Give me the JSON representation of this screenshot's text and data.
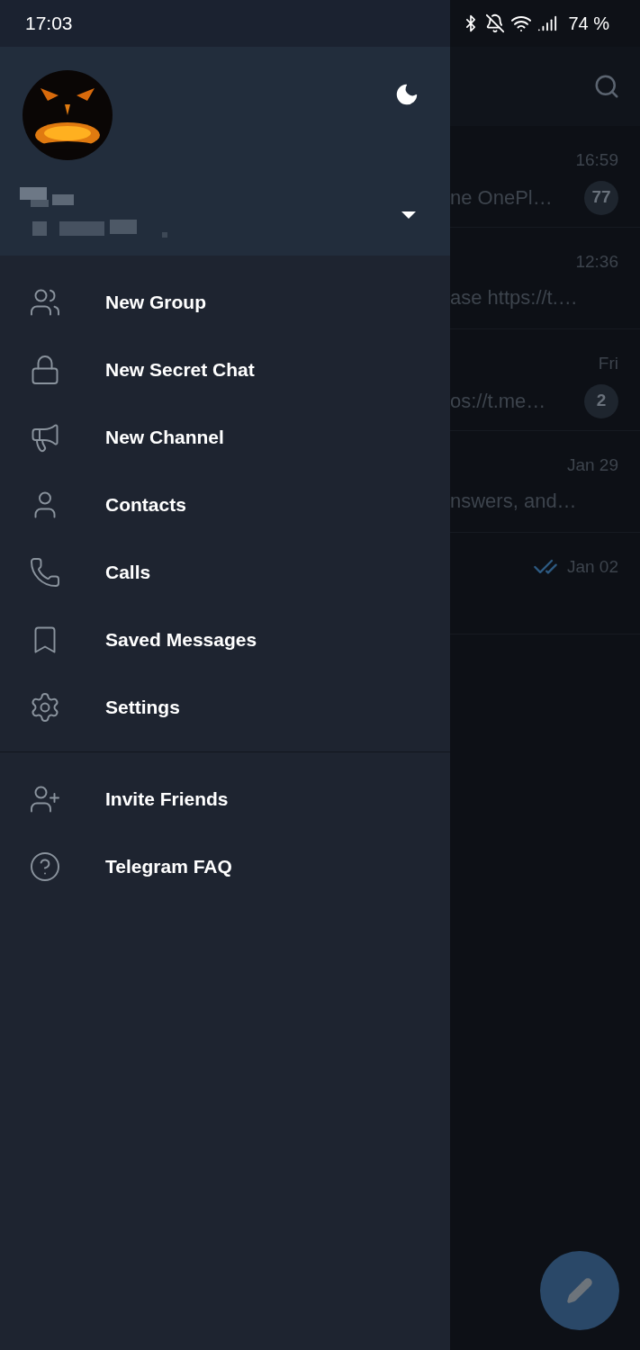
{
  "status_bar": {
    "time": "17:03",
    "battery": "74 %"
  },
  "drawer": {
    "menu": [
      {
        "kind": "group",
        "label": "New Group"
      },
      {
        "kind": "lock",
        "label": "New Secret Chat"
      },
      {
        "kind": "channel",
        "label": "New Channel"
      },
      {
        "kind": "contacts",
        "label": "Contacts"
      },
      {
        "kind": "calls",
        "label": "Calls"
      },
      {
        "kind": "saved",
        "label": "Saved Messages"
      },
      {
        "kind": "settings",
        "label": "Settings"
      }
    ],
    "extra_menu": [
      {
        "kind": "invite",
        "label": "Invite Friends"
      },
      {
        "kind": "faq",
        "label": "Telegram FAQ"
      }
    ]
  },
  "chats": [
    {
      "time": "16:59",
      "preview": "ne OnePl…",
      "badge": "77",
      "read": false
    },
    {
      "time": "12:36",
      "preview": "ase  https://t.…",
      "read": false
    },
    {
      "time": "Fri",
      "preview": "os://t.me…",
      "badge": "2",
      "read": false
    },
    {
      "time": "Jan 29",
      "preview": "nswers, and…",
      "read": false
    },
    {
      "time": "Jan 02",
      "read": true
    }
  ]
}
